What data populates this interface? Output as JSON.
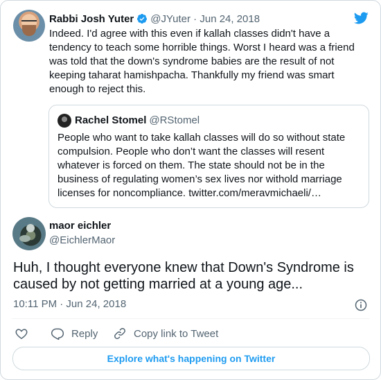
{
  "parent_tweet": {
    "name": "Rabbi Josh Yuter",
    "handle_time": "@JYuter · Jun 24, 2018",
    "text": "Indeed. I'd agree with this even if kallah classes didn't have a tendency to teach some horrible things. Worst I heard was a friend was told that the down's syndrome babies are the result of not keeping taharat hamishpacha. Thankfully my friend was smart enough to reject this."
  },
  "quoted_tweet": {
    "name": "Rachel Stomel",
    "handle": "@RStomel",
    "text": "People who want to take kallah classes will do so without state compulsion. People who don’t want the classes will resent whatever is forced on them. The state should not be in the business of regulating women’s sex lives nor withold marriage licenses for noncompliance. twitter.com/meravmichaeli/…"
  },
  "main_tweet": {
    "name": "maor eichler",
    "handle": "@EichlerMaor",
    "text": "Huh, I thought everyone knew that Down's Syndrome is caused by not getting married at a young age...",
    "timestamp": "10:11 PM · Jun 24, 2018"
  },
  "actions": {
    "reply_label": "Reply",
    "copy_label": "Copy link to Tweet"
  },
  "explore_label": "Explore what's happening on Twitter",
  "colors": {
    "twitter_blue": "#1d9bf0",
    "secondary_text": "#536471",
    "border": "#cfd9de"
  },
  "icons": [
    "verified-badge-icon",
    "twitter-bird-icon",
    "info-icon",
    "heart-icon",
    "reply-icon",
    "link-icon"
  ]
}
